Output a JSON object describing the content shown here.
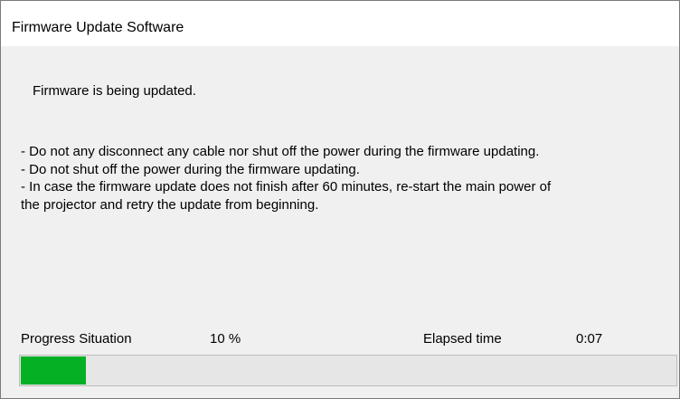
{
  "window": {
    "title": "Firmware Update Software"
  },
  "main": {
    "status_text": "Firmware is being updated.",
    "warnings": [
      "- Do not any disconnect any cable nor shut off the power during the firmware updating.",
      "- Do not shut off the power during the firmware updating.",
      "- In case the firmware update does not finish after 60 minutes, re-start the main power of",
      "the projector and retry the update from beginning."
    ]
  },
  "progress": {
    "label": "Progress Situation",
    "value_text": "10 %",
    "fraction": 0.1,
    "elapsed_label": "Elapsed time",
    "elapsed_value": "0:07"
  },
  "colors": {
    "progress_fill": "#06b025",
    "progress_track": "#e6e6e6",
    "titlebar": "#ffffff",
    "background": "#f0f0f0"
  }
}
